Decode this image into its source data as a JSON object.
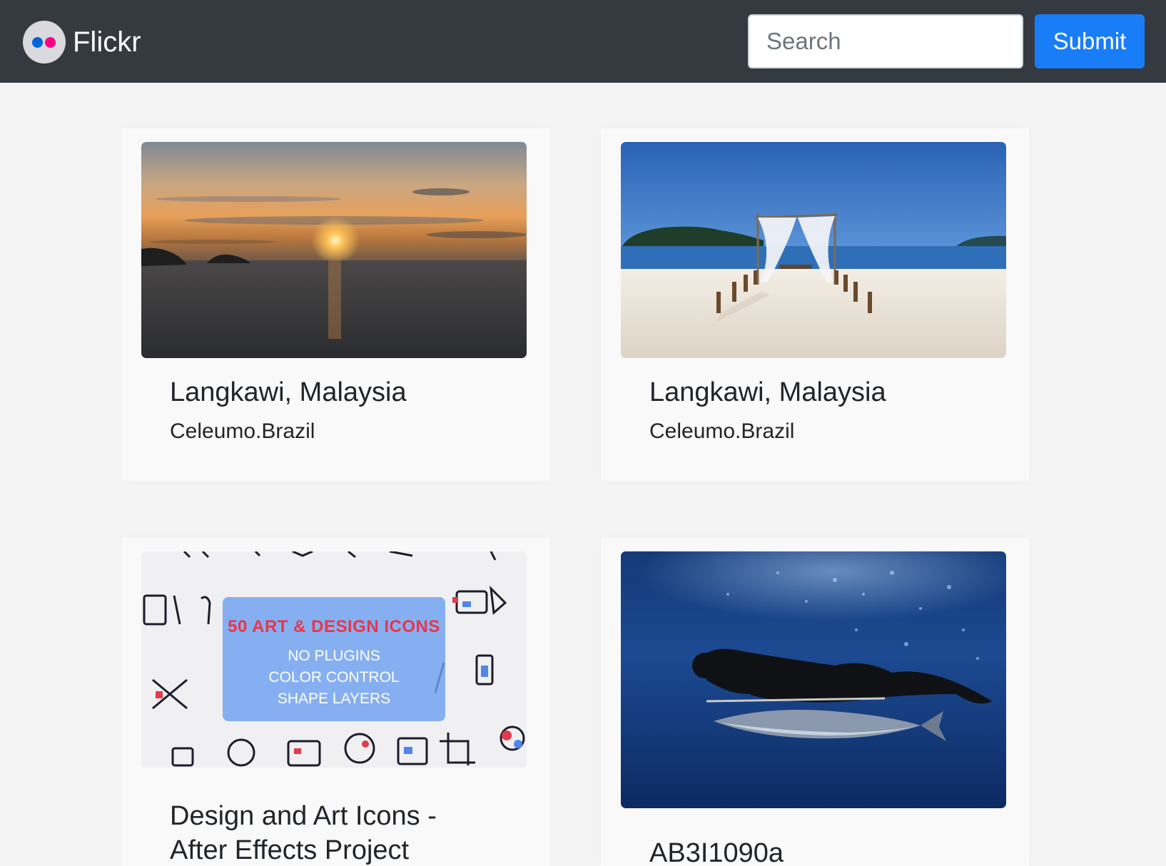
{
  "nav": {
    "brand": "Flickr",
    "search_placeholder": "Search",
    "submit_label": "Submit"
  },
  "photos": [
    {
      "title": "Langkawi, Malaysia",
      "author": "Celeumo.Brazil",
      "image": "sunset over sea with islands"
    },
    {
      "title": "Langkawi, Malaysia",
      "author": "Celeumo.Brazil",
      "image": "beach wedding canopy on white sand"
    },
    {
      "title": "Design and Art Icons - After Effects Project",
      "author": "",
      "image": "art and design icons promo",
      "overlay": {
        "heading": "50 ART & DESIGN ICONS",
        "lines": [
          "NO PLUGINS",
          "COLOR CONTROL",
          "SHAPE LAYERS"
        ]
      }
    },
    {
      "title": "AB3I1090a",
      "author": "",
      "image": "underwater spearfisher with tuna"
    }
  ],
  "colors": {
    "navbar": "#343a40",
    "submit": "#1a7df8",
    "flickr_blue": "#0063dc",
    "flickr_pink": "#ff0084"
  }
}
